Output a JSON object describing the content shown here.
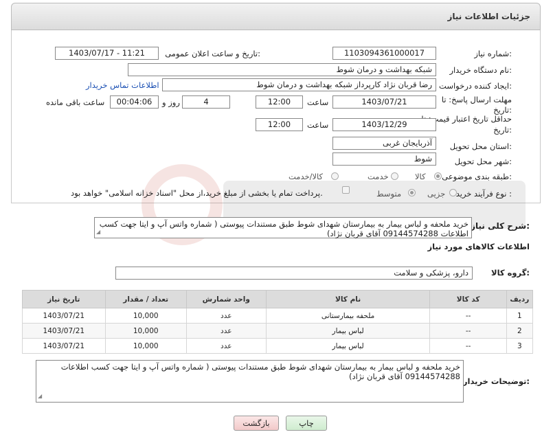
{
  "header": {
    "title": "جزئیات اطلاعات نیاز"
  },
  "fields": {
    "need_number_label": "شماره نیاز:",
    "need_number": "1103094361000017",
    "announce_label": "تاریخ و ساعت اعلان عمومی:",
    "announce_value": "1403/07/17 - 11:21",
    "buyer_org_label": "نام دستگاه خریدار:",
    "buyer_org": "شبکه بهداشت و درمان شوط",
    "requester_label": "ایجاد کننده درخواست:",
    "requester": "رضا قربان نژاد کارپرداز شبکه بهداشت و درمان شوط",
    "contact_link": "اطلاعات تماس خریدار",
    "deadline_label_1": "مهلت ارسال پاسخ: تا",
    "deadline_label_2": "تاریخ:",
    "deadline_date": "1403/07/21",
    "time_label": "ساعت",
    "deadline_time": "12:00",
    "days_value": "4",
    "days_label": "روز و",
    "remaining_time": "00:04:06",
    "remaining_label": "ساعت باقی مانده",
    "validity_label_1": "حداقل تاریخ اعتبار قیمت: تا",
    "validity_label_2": "تاریخ:",
    "validity_date": "1403/12/29",
    "validity_time": "12:00",
    "province_label": "استان محل تحویل:",
    "province": "آذربایجان غربی",
    "city_label": "شهر محل تحویل:",
    "city": "شوط",
    "category_label": "طبقه بندی موضوعی:",
    "category_options": [
      "کالا",
      "خدمت",
      "کالا/خدمت"
    ],
    "process_label": "نوع فرآیند خرید :",
    "process_options": [
      "جزیی",
      "متوسط"
    ],
    "payment_note": "پرداخت تمام یا بخشی از مبلغ خرید،از محل \"اسناد خزانه اسلامی\" خواهد بود."
  },
  "description": {
    "label": "شرح کلی نیاز:",
    "text": "خرید ملحفه و لباس بیمار به بیمارستان شهدای شوط طبق مستندات پیوستی ( شماره واتس آپ و ایتا جهت کسب اطلاعات 09144574288 آقای قربان نژاد)"
  },
  "goods": {
    "section_title": "اطلاعات کالاهای مورد نیاز",
    "group_label": "گروه کالا:",
    "group_value": "دارو، پزشکی و سلامت",
    "columns": [
      "ردیف",
      "کد کالا",
      "نام کالا",
      "واحد شمارش",
      "تعداد / مقدار",
      "تاریخ نیاز"
    ],
    "rows": [
      {
        "idx": "1",
        "code": "--",
        "name": "ملحفه بیمارستانی",
        "unit": "عدد",
        "qty": "10,000",
        "date": "1403/07/21"
      },
      {
        "idx": "2",
        "code": "--",
        "name": "لباس بیمار",
        "unit": "عدد",
        "qty": "10,000",
        "date": "1403/07/21"
      },
      {
        "idx": "3",
        "code": "--",
        "name": "لباس بیمار",
        "unit": "عدد",
        "qty": "10,000",
        "date": "1403/07/21"
      }
    ]
  },
  "buyer_notes": {
    "label": "توضیحات خریدار:",
    "text": "خرید ملحفه و لباس بیمار به بیمارستان شهدای شوط طبق مستندات پیوستی ( شماره واتس آپ و ایتا جهت کسب اطلاعات 09144574288 آقای قربان نژاد)"
  },
  "buttons": {
    "print": "چاپ",
    "back": "بازگشت"
  },
  "colors": {
    "link": "#1a4fb3",
    "header_bg": "#dcdcdc",
    "print_bg": "#cfeccf",
    "back_bg": "#f2c9c9"
  }
}
